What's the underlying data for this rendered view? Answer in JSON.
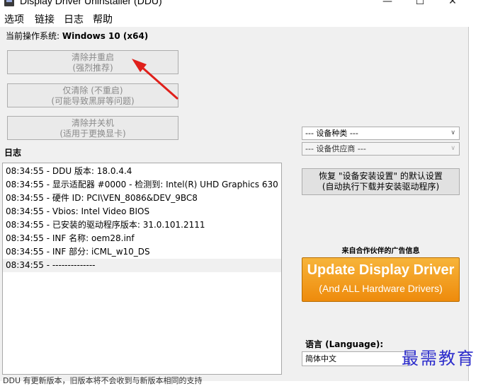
{
  "window": {
    "title": "Display Driver Uninstaller (DDU)",
    "minimize": "—",
    "maximize": "☐",
    "close": "✕"
  },
  "menu": [
    "选项",
    "链接",
    "日志",
    "帮助"
  ],
  "os": {
    "label": "当前操作系统:",
    "value": "Windows 10 (x64)"
  },
  "actions": [
    {
      "line1": "清除并重启",
      "line2": "(强烈推荐)"
    },
    {
      "line1": "仅清除 (不重启)",
      "line2": "(可能导致黑屏等问题)"
    },
    {
      "line1": "清除并关机",
      "line2": "(适用于更换显卡)"
    }
  ],
  "log": {
    "title": "日志",
    "lines": [
      "08:34:55 - DDU 版本: 18.0.4.4",
      "08:34:55 - 显示适配器 #0000 - 检测到: Intel(R) UHD Graphics 630",
      "08:34:55 - 硬件 ID: PCI\\VEN_8086&DEV_9BC8",
      "08:34:55 - Vbios: Intel Video BIOS",
      "08:34:55 - 已安装的驱动程序版本: 31.0.101.2111",
      "08:34:55 - INF 名称: oem28.inf",
      "08:34:55 - INF 部分: iCML_w10_DS",
      "08:34:55 - --------------"
    ]
  },
  "device_type": {
    "selected": "--- 设备种类 ---"
  },
  "device_vendor": {
    "selected": "--- 设备供应商 ---"
  },
  "restore_button": {
    "line1": "恢复 \"设备安装设置\" 的默认设置",
    "line2": "(自动执行下载并安装驱动程序)"
  },
  "ad": {
    "title": "来自合作伙伴的广告信息",
    "line1": "Update Display Driver",
    "line2": "(And ALL Hardware Drivers)"
  },
  "language": {
    "label": "语言 (Language):",
    "selected": "简体中文"
  },
  "watermark": "最需教育",
  "status": "DDU 有更新版本，旧版本将不会收到与新版本相同的支持",
  "colors": {
    "ad_orange": "#ee8b0c",
    "annotation_red": "#e0201b",
    "watermark_blue": "#2d2dcc"
  }
}
